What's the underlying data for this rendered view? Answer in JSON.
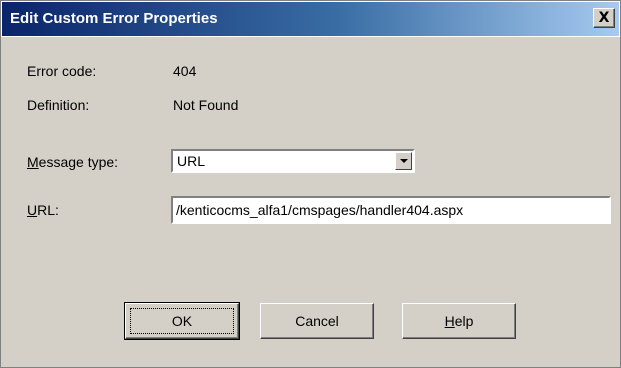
{
  "window": {
    "title": "Edit Custom Error Properties",
    "close_label": "X"
  },
  "fields": {
    "error_code_label": "Error code:",
    "error_code_value": "404",
    "definition_label": "Definition:",
    "definition_value": "Not Found",
    "message_type_label_accel": "M",
    "message_type_label_rest": "essage type:",
    "message_type_value": "URL",
    "url_label_accel": "U",
    "url_label_rest": "RL:",
    "url_value": "/kenticocms_alfa1/cmspages/handler404.aspx"
  },
  "buttons": {
    "ok_label": "OK",
    "cancel_label": "Cancel",
    "help_label_accel": "H",
    "help_label_rest": "elp"
  },
  "colors": {
    "titlebar_start": "#0a246a",
    "titlebar_end": "#a6caf0",
    "dialog_bg": "#d4d0c8"
  },
  "icons": {
    "close": "close-icon",
    "dropdown": "chevron-down-icon"
  }
}
